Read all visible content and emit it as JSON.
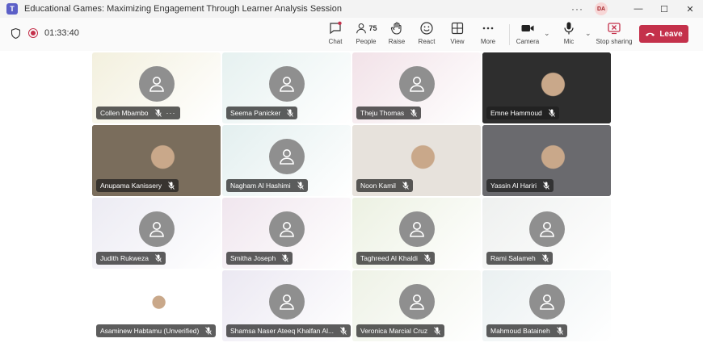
{
  "window": {
    "title": "Educational Games: Maximizing Engagement Through Learner Analysis Session",
    "avatar_initials": "DA",
    "app_icon": "T"
  },
  "toolbar": {
    "timer": "01:33:40",
    "people_count": "75",
    "chat": "Chat",
    "people": "People",
    "raise": "Raise",
    "react": "React",
    "view": "View",
    "more": "More",
    "camera": "Camera",
    "mic": "Mic",
    "share": "Stop sharing",
    "leave": "Leave"
  },
  "colors": {
    "accent": "#5b5fc7",
    "leave": "#c4314b"
  },
  "participants": [
    {
      "name": "Collen Mbambo",
      "muted": true,
      "more": true,
      "video": false,
      "bg": "#f3f0de"
    },
    {
      "name": "Seema Panicker",
      "muted": true,
      "video": false,
      "bg": "#e6f1f0"
    },
    {
      "name": "Theju Thomas",
      "muted": true,
      "video": false,
      "bg": "#f2e2e8"
    },
    {
      "name": "Emne Hammoud",
      "muted": true,
      "video": true,
      "bg": "#2e2e2e"
    },
    {
      "name": "Anupama Kanissery",
      "muted": true,
      "video": true,
      "bg": "#7a6d5c"
    },
    {
      "name": "Nagham Al Hashimi",
      "muted": true,
      "video": false,
      "bg": "#e3efef"
    },
    {
      "name": "Noon Kamil",
      "muted": true,
      "video": true,
      "bg": "#e7e2dc"
    },
    {
      "name": "Yassin Al Hariri",
      "muted": true,
      "video": true,
      "bg": "#6a6a6e"
    },
    {
      "name": "Judith Rukweza",
      "muted": true,
      "video": false,
      "bg": "#ecebf3"
    },
    {
      "name": "Smitha Joseph",
      "muted": true,
      "video": false,
      "bg": "#f0e6ee"
    },
    {
      "name": "Taghreed Al Khaldi",
      "muted": true,
      "video": false,
      "bg": "#ecf1e2"
    },
    {
      "name": "Rami Salameh",
      "muted": true,
      "video": false,
      "bg": "#eef0ef"
    },
    {
      "name": "Asaminew Habtamu (Unverified)",
      "muted": true,
      "video": true,
      "bg": "#ffffff"
    },
    {
      "name": "Shamsa Naser Ateeq Khalfan Al...",
      "muted": true,
      "video": false,
      "bg": "#ebe8f2"
    },
    {
      "name": "Veronica Marcial Cruz",
      "muted": true,
      "video": false,
      "bg": "#eef2e6"
    },
    {
      "name": "Mahmoud Bataineh",
      "muted": true,
      "video": false,
      "bg": "#eaf0f1"
    }
  ]
}
